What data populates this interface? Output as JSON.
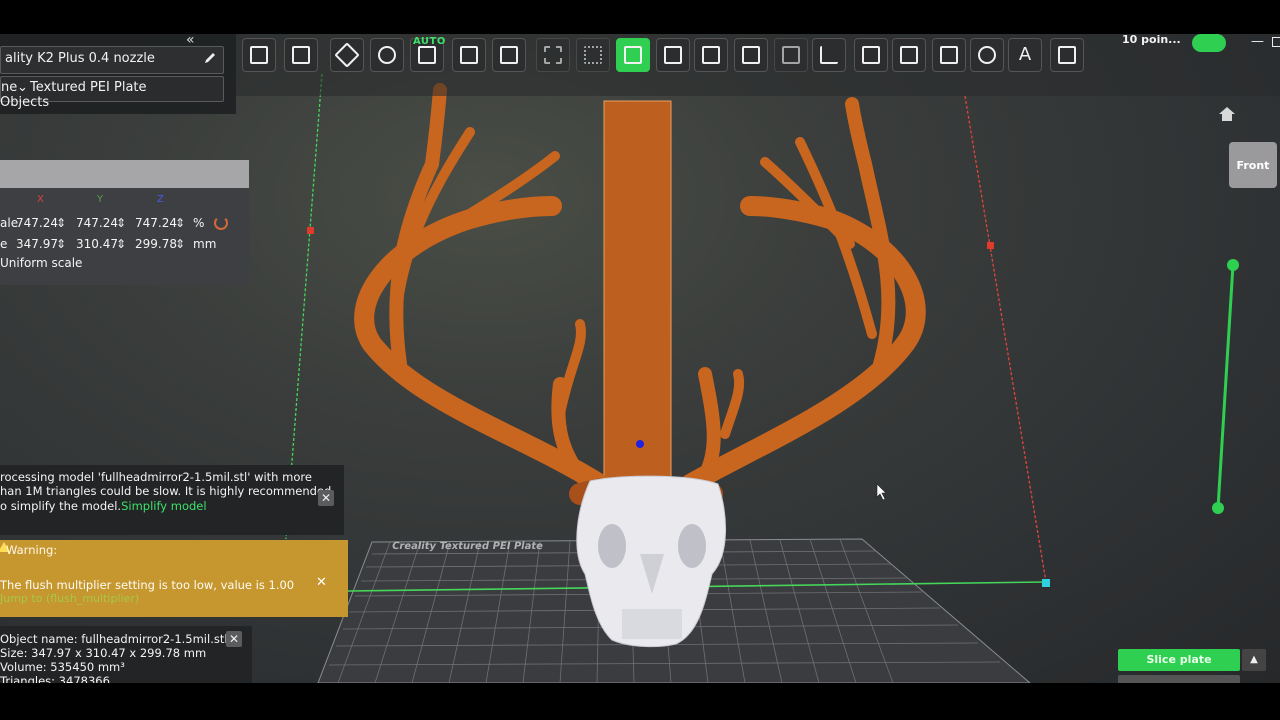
{
  "top_bar": {
    "printer": "ality K2 Plus 0.4 nozzle",
    "plate_prefix": "ne",
    "plate_type": "Textured PEI Plate",
    "objects_label": "Objects",
    "points_label": "10 poin...",
    "auto_label": "AUTO",
    "window_minimize": "—"
  },
  "toolbar": {
    "icons": [
      "add-cube-icon",
      "add-plate-icon",
      "arrange-icon",
      "orient-icon",
      "auto-orient-icon",
      "layout-icon",
      "erase-icon",
      "grid-icon",
      "dots-icon",
      "scale-icon",
      "box-icon",
      "cube-icon",
      "cut-icon",
      "boolean-icon",
      "measure-icon",
      "emboss-icon",
      "support-icon",
      "seam-icon",
      "paint-icon",
      "text-icon",
      "assembly-icon"
    ],
    "active_index": 9
  },
  "scale_panel": {
    "axis_x": "X",
    "axis_y": "Y",
    "axis_z": "Z",
    "row1_label": "ale",
    "row1_x": "747.24",
    "row1_y": "747.24",
    "row1_z": "747.24",
    "row1_unit": "%",
    "row2_label": "e",
    "row2_x": "347.97",
    "row2_y": "310.47",
    "row2_z": "299.78",
    "row2_unit": "mm",
    "uniform_label": "Uniform scale"
  },
  "notice": {
    "line1": "rocessing model 'fullheadmirror2-1.5mil.stl' with more",
    "line2": "han 1M triangles could be slow. It is highly recommended",
    "line3_prefix": "o simplify the model.",
    "line3_link": "Simplify model"
  },
  "warning": {
    "title": "Warning:",
    "message": "The flush multiplier setting is too low, value is 1.00",
    "jump": "Jump to (flush_multiplier)"
  },
  "object_info": {
    "name": "Object name: fullheadmirror2-1.5mil.stl",
    "size": "Size: 347.97 x 310.47 x 299.78 mm",
    "volume": "Volume: 535450 mm³",
    "triangles": "Triangles: 3478366"
  },
  "view": {
    "front_label": "Front",
    "plate_label": "Creality Textured PEI Plate"
  },
  "actions": {
    "slice_label": "Slice plate",
    "slice_arrow": "▲"
  },
  "colors": {
    "accent_green": "#2fcf52",
    "model_orange": "#c8651e",
    "warning_bg": "#c6962f"
  }
}
